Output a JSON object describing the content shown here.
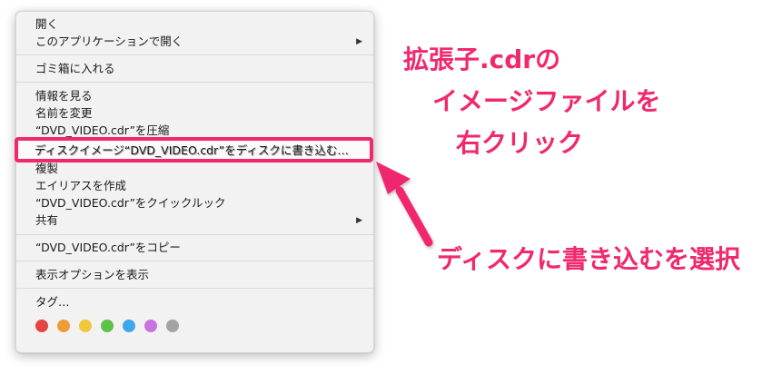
{
  "menu": {
    "items": [
      {
        "label": "開く",
        "submenu": false
      },
      {
        "label": "このアプリケーションで開く",
        "submenu": true
      },
      {
        "label": "ゴミ箱に入れる",
        "submenu": false
      },
      {
        "label": "情報を見る",
        "submenu": false
      },
      {
        "label": "名前を変更",
        "submenu": false
      },
      {
        "label": "“DVD_VIDEO.cdr”を圧縮",
        "submenu": false
      },
      {
        "label": "ディスクイメージ“DVD_VIDEO.cdr”をディスクに書き込む…",
        "submenu": false
      },
      {
        "label": "複製",
        "submenu": false
      },
      {
        "label": "エイリアスを作成",
        "submenu": false
      },
      {
        "label": "“DVD_VIDEO.cdr”をクイックルック",
        "submenu": false
      },
      {
        "label": "共有",
        "submenu": true
      },
      {
        "label": "“DVD_VIDEO.cdr”をコピー",
        "submenu": false
      },
      {
        "label": "表示オプションを表示",
        "submenu": false
      },
      {
        "label": "タグ…",
        "submenu": false
      }
    ],
    "submenu_arrow": "▶",
    "tag_colors": [
      {
        "name": "red",
        "color": "#e5453f"
      },
      {
        "name": "orange",
        "color": "#f19a38"
      },
      {
        "name": "yellow",
        "color": "#efc93a"
      },
      {
        "name": "green",
        "color": "#5fc04a"
      },
      {
        "name": "blue",
        "color": "#3da7ec"
      },
      {
        "name": "purple",
        "color": "#c874de"
      },
      {
        "name": "gray",
        "color": "#a3a3a3"
      }
    ]
  },
  "annotations": {
    "line1": "拡張子.cdrの",
    "line2": "イメージファイルを",
    "line3": "右クリック",
    "line4": "ディスクに書き込むを選択",
    "color": "#f0286e"
  }
}
